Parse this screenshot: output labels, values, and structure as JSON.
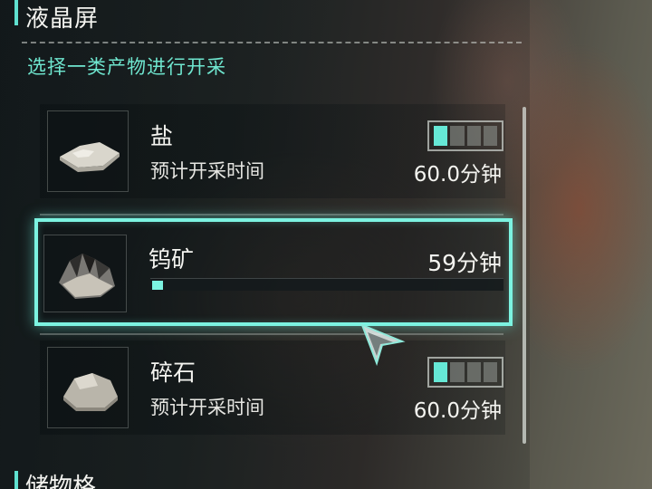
{
  "header": {
    "title": "液晶屏",
    "subtitle": "选择一类产物进行开采"
  },
  "products": [
    {
      "name": "盐",
      "label": "预计开采时间",
      "time": "60.0分钟",
      "icon": "salt-icon",
      "level_segments": 4,
      "level_filled": 1
    },
    {
      "name": "钨矿",
      "time": "59分钟",
      "icon": "tungsten-ore-icon",
      "progress": 0.02,
      "selected": true
    },
    {
      "name": "碎石",
      "label": "预计开采时间",
      "time": "60.0分钟",
      "icon": "gravel-icon",
      "level_segments": 4,
      "level_filled": 1
    }
  ],
  "storage": {
    "title": "储物格"
  },
  "colors": {
    "accent": "#66e8d6",
    "highlight": "#7cf3e1",
    "text": "#f4f4f0"
  }
}
